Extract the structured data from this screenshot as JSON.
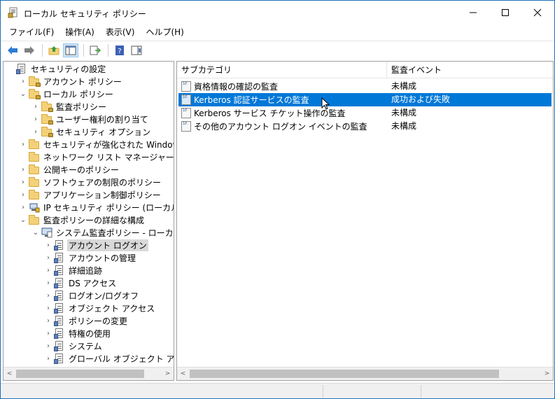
{
  "window": {
    "title": "ローカル セキュリティ ポリシー"
  },
  "menu": [
    "ファイル(F)",
    "操作(A)",
    "表示(V)",
    "ヘルプ(H)"
  ],
  "toolbar": {
    "buttons": [
      "back-arrow-icon",
      "forward-arrow-icon",
      "up-folder-icon",
      "show-hide-tree-icon",
      "export-list-icon",
      "help-icon",
      "action-pane-icon"
    ]
  },
  "tree": {
    "items": [
      {
        "label": "セキュリティの設定",
        "depth": 0,
        "expander": "",
        "icon": "policy"
      },
      {
        "label": "アカウント ポリシー",
        "depth": 1,
        "expander": "›",
        "icon": "folder-lock"
      },
      {
        "label": "ローカル ポリシー",
        "depth": 1,
        "expander": "⌄",
        "icon": "folder-lock"
      },
      {
        "label": "監査ポリシー",
        "depth": 2,
        "expander": "›",
        "icon": "folder-lock"
      },
      {
        "label": "ユーザー権利の割り当て",
        "depth": 2,
        "expander": "›",
        "icon": "folder-lock"
      },
      {
        "label": "セキュリティ オプション",
        "depth": 2,
        "expander": "›",
        "icon": "folder-lock"
      },
      {
        "label": "セキュリティが強化された Windows ファイア",
        "depth": 1,
        "expander": "›",
        "icon": "folder"
      },
      {
        "label": "ネットワーク リスト マネージャー ポリシー",
        "depth": 1,
        "expander": "",
        "icon": "folder"
      },
      {
        "label": "公開キーのポリシー",
        "depth": 1,
        "expander": "›",
        "icon": "folder"
      },
      {
        "label": "ソフトウェアの制限のポリシー",
        "depth": 1,
        "expander": "›",
        "icon": "folder"
      },
      {
        "label": "アプリケーション制御ポリシー",
        "depth": 1,
        "expander": "›",
        "icon": "folder"
      },
      {
        "label": "IP セキュリティ ポリシー (ローカル コンピュータ",
        "depth": 1,
        "expander": "›",
        "icon": "ipsec"
      },
      {
        "label": "監査ポリシーの詳細な構成",
        "depth": 1,
        "expander": "⌄",
        "icon": "folder"
      },
      {
        "label": "システム監査ポリシー - ローカル グループ",
        "depth": 2,
        "expander": "⌄",
        "icon": "computer"
      },
      {
        "label": "アカウント ログオン",
        "depth": 3,
        "expander": "›",
        "icon": "policy",
        "selected": true
      },
      {
        "label": "アカウントの管理",
        "depth": 3,
        "expander": "›",
        "icon": "policy"
      },
      {
        "label": "詳細追跡",
        "depth": 3,
        "expander": "›",
        "icon": "policy"
      },
      {
        "label": "DS アクセス",
        "depth": 3,
        "expander": "›",
        "icon": "policy"
      },
      {
        "label": "ログオン/ログオフ",
        "depth": 3,
        "expander": "›",
        "icon": "policy"
      },
      {
        "label": "オブジェクト アクセス",
        "depth": 3,
        "expander": "›",
        "icon": "policy"
      },
      {
        "label": "ポリシーの変更",
        "depth": 3,
        "expander": "›",
        "icon": "policy"
      },
      {
        "label": "特権の使用",
        "depth": 3,
        "expander": "›",
        "icon": "policy"
      },
      {
        "label": "システム",
        "depth": 3,
        "expander": "›",
        "icon": "policy"
      },
      {
        "label": "グローバル オブジェクト アクセスの監",
        "depth": 3,
        "expander": "›",
        "icon": "policy"
      }
    ]
  },
  "list": {
    "columns": [
      "サブカテゴリ",
      "監査イベント"
    ],
    "rows": [
      {
        "name": "資格情報の確認の監査",
        "event": "未構成"
      },
      {
        "name": "Kerberos 認証サービスの監査",
        "event": "成功および失敗",
        "selected": true
      },
      {
        "name": "Kerberos サービス チケット操作の監査",
        "event": "未構成"
      },
      {
        "name": "その他のアカウント ログオン イベントの監査",
        "event": "未構成"
      }
    ]
  },
  "scroll": {
    "left_arrow": "<",
    "right_arrow": ">"
  }
}
